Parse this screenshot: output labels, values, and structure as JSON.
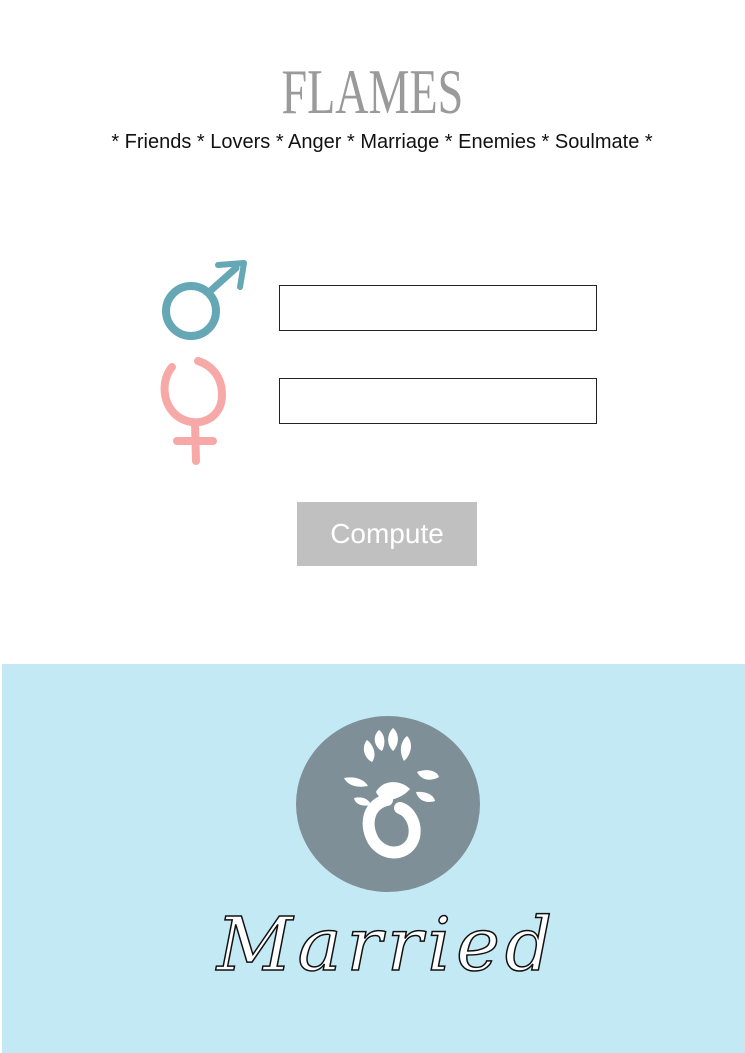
{
  "app": {
    "title": "FLAMES",
    "subtitle": "* Friends * Lovers * Anger * Marriage * Enemies * Soulmate *"
  },
  "form": {
    "male_icon": "male-symbol-icon",
    "female_icon": "female-symbol-icon",
    "male_name_value": "",
    "female_name_value": "",
    "compute_label": "Compute"
  },
  "result": {
    "icon": "diamond-ring-icon",
    "label": "Married"
  },
  "colors": {
    "male": "#65a7b4",
    "female": "#f7a9a8",
    "button": "#c0c0c0",
    "result_background": "#c3e9f5",
    "badge": "#7f8f98",
    "title": "#9a9a9a"
  }
}
